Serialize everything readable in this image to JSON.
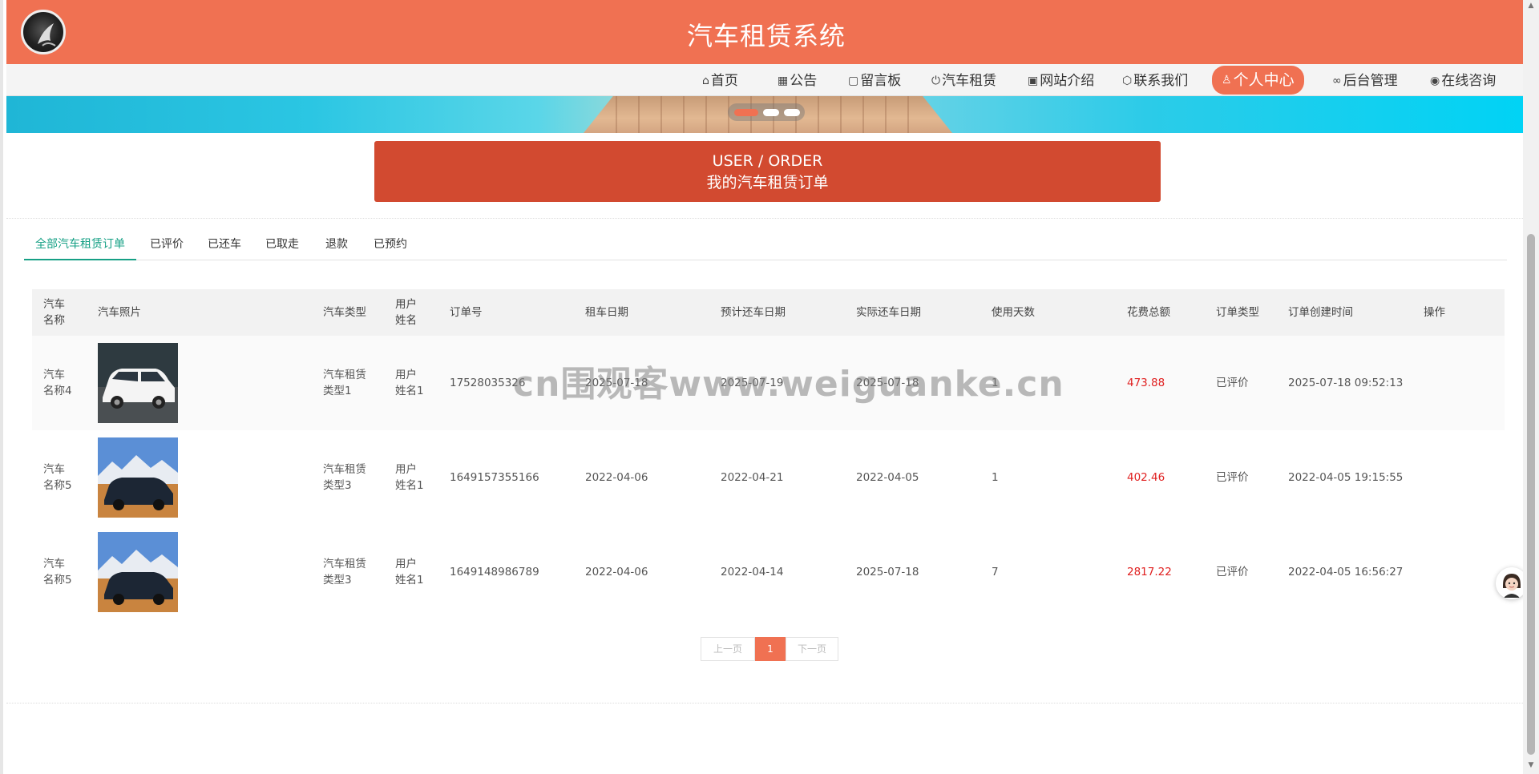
{
  "header": {
    "title": "汽车租赁系统"
  },
  "nav": [
    {
      "icon": "home-icon",
      "glyph": "⌂",
      "label": "首页"
    },
    {
      "icon": "notice-icon",
      "glyph": "▦",
      "label": "公告"
    },
    {
      "icon": "message-board-icon",
      "glyph": "▢",
      "label": "留言板"
    },
    {
      "icon": "power-icon",
      "glyph": "⏻",
      "label": "汽车租赁"
    },
    {
      "icon": "gift-icon",
      "glyph": "▣",
      "label": "网站介绍"
    },
    {
      "icon": "cube-icon",
      "glyph": "⬡",
      "label": "联系我们"
    },
    {
      "icon": "user-icon",
      "glyph": "♙",
      "label": "个人中心"
    },
    {
      "icon": "link-icon",
      "glyph": "∞",
      "label": "后台管理"
    },
    {
      "icon": "wechat-icon",
      "glyph": "◉",
      "label": "在线咨询"
    }
  ],
  "order_head": {
    "en": "USER / ORDER",
    "zh": "我的汽车租赁订单"
  },
  "tabs": [
    "全部汽车租赁订单",
    "已评价",
    "已还车",
    "已取走",
    "退款",
    "已预约"
  ],
  "columns": [
    "汽车名称",
    "汽车照片",
    "汽车类型",
    "用户姓名",
    "订单号",
    "租车日期",
    "预计还车日期",
    "实际还车日期",
    "使用天数",
    "花费总额",
    "订单类型",
    "订单创建时间",
    "操作"
  ],
  "rows": [
    {
      "car_name": "汽车名称4",
      "car_type": "汽车租赁类型1",
      "user": "用户姓名1",
      "order_no": "17528035326",
      "rent_date": "2025-07-18",
      "expected_return": "2025-07-19",
      "actual_return": "2025-07-18",
      "days": "1",
      "total": "473.88",
      "order_type": "已评价",
      "created": "2025-07-18 09:52:13",
      "photo": "white-mpv"
    },
    {
      "car_name": "汽车名称5",
      "car_type": "汽车租赁类型3",
      "user": "用户姓名1",
      "order_no": "1649157355166",
      "rent_date": "2022-04-06",
      "expected_return": "2022-04-21",
      "actual_return": "2022-04-05",
      "days": "1",
      "total": "402.46",
      "order_type": "已评价",
      "created": "2022-04-05 19:15:55",
      "photo": "dark-suv"
    },
    {
      "car_name": "汽车名称5",
      "car_type": "汽车租赁类型3",
      "user": "用户姓名1",
      "order_no": "1649148986789",
      "rent_date": "2022-04-06",
      "expected_return": "2022-04-14",
      "actual_return": "2025-07-18",
      "days": "7",
      "total": "2817.22",
      "order_type": "已评价",
      "created": "2022-04-05 16:56:27",
      "photo": "dark-suv"
    }
  ],
  "pager": {
    "prev": "上一页",
    "current": "1",
    "next": "下一页"
  },
  "watermark": "cn围观客www.weiguanke.cn",
  "colors": {
    "primary": "#f07152",
    "heading": "#d24a30",
    "active_tab": "#16a085",
    "price": "#e02020"
  }
}
